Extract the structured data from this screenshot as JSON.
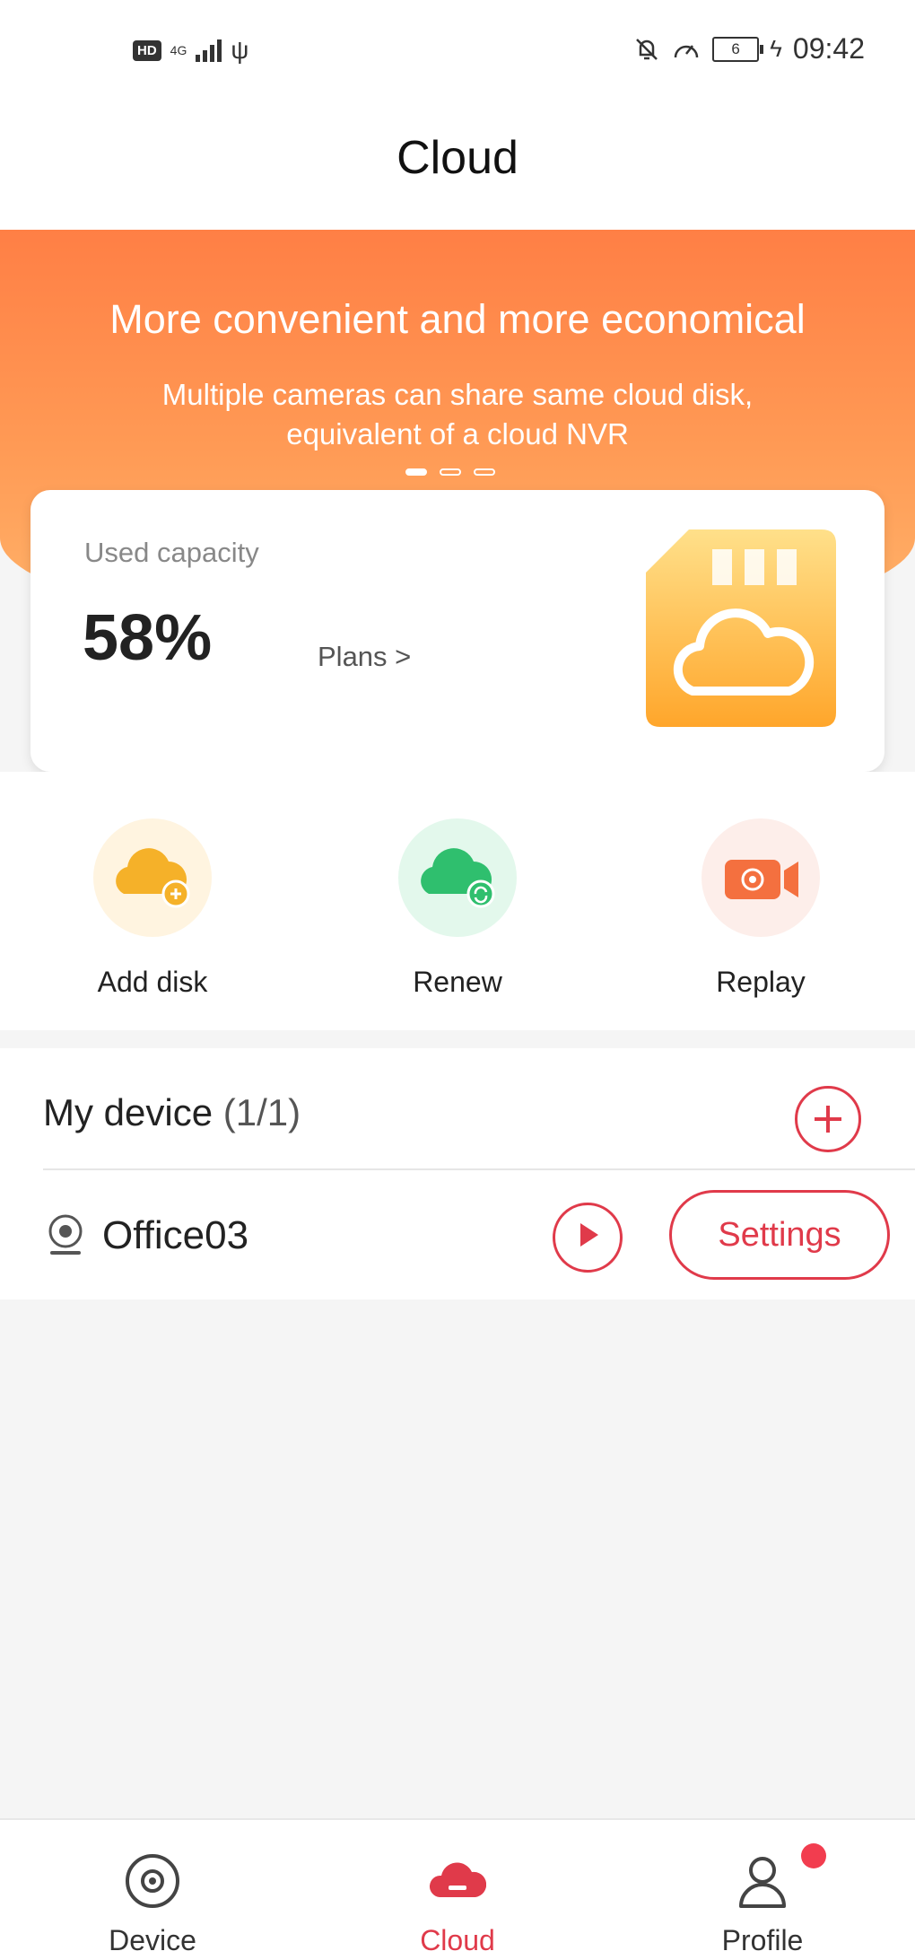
{
  "status_bar": {
    "hd": "HD",
    "network": "4G",
    "time": "09:42",
    "battery": "6"
  },
  "header": {
    "title": "Cloud"
  },
  "banner": {
    "title": "More convenient and more economical",
    "subtitle": "Multiple cameras can share same cloud disk, equivalent of a cloud NVR",
    "pages": 3,
    "active_page": 1
  },
  "capacity": {
    "label": "Used capacity",
    "value": "58%",
    "plans_link": "Plans >"
  },
  "actions": [
    {
      "label": "Add disk",
      "icon": "cloud-add-icon",
      "color": "#f5b129"
    },
    {
      "label": "Renew",
      "icon": "cloud-renew-icon",
      "color": "#2fbf6e"
    },
    {
      "label": "Replay",
      "icon": "video-camera-icon",
      "color": "#f4703f"
    }
  ],
  "devices": {
    "title": "My device",
    "count": "(1/1)",
    "items": [
      {
        "name": "Office03",
        "settings_label": "Settings"
      }
    ]
  },
  "tabbar": {
    "tabs": [
      {
        "label": "Device",
        "icon": "device-icon",
        "active": false
      },
      {
        "label": "Cloud",
        "icon": "cloud-icon",
        "active": true
      },
      {
        "label": "Profile",
        "icon": "profile-icon",
        "active": false,
        "badge": true
      }
    ]
  },
  "colors": {
    "accent": "#e03a4a",
    "banner": "#ff8a4c"
  }
}
